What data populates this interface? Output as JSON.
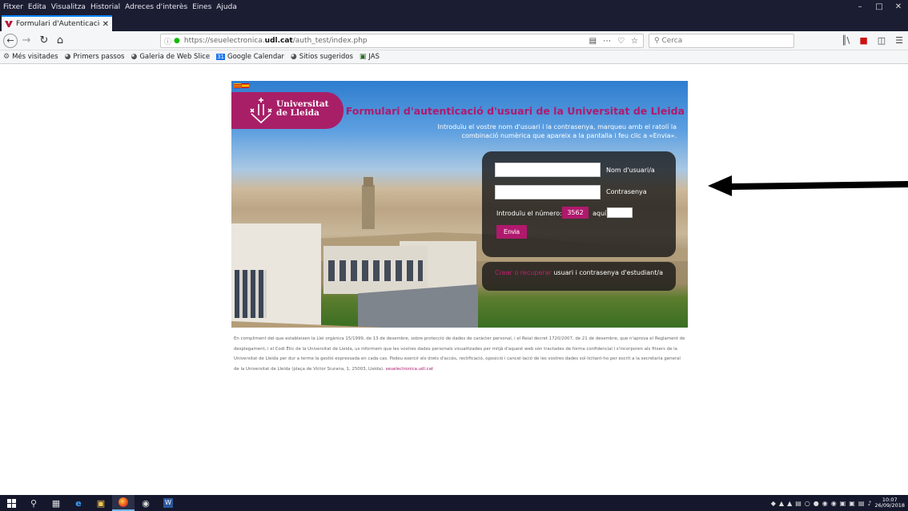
{
  "menubar": {
    "items": [
      "Fitxer",
      "Edita",
      "Visualitza",
      "Historial",
      "Adreces d'interès",
      "Eines",
      "Ajuda"
    ]
  },
  "tab": {
    "title": "Formulari d'Autenticació d'usu"
  },
  "address": {
    "url_prefix": "https://seuelectronica.",
    "url_host": "udl.cat",
    "url_path": "/auth_test/index.php"
  },
  "search": {
    "placeholder": "Cerca"
  },
  "bookmarks": [
    {
      "label": "Més visitades",
      "icon": "gear-icon"
    },
    {
      "label": "Primers passos",
      "icon": "globe-icon"
    },
    {
      "label": "Galeria de Web Slice",
      "icon": "globe-icon"
    },
    {
      "label": "Google Calendar",
      "icon": "calendar-icon"
    },
    {
      "label": "Sitios sugeridos",
      "icon": "globe-icon"
    },
    {
      "label": "JAS",
      "icon": "folder-icon"
    }
  ],
  "page": {
    "logo_line1": "Universitat",
    "logo_line2": "de Lleida",
    "form_title": "Formulari d'autenticació d'usuari de la Universitat de Lleida",
    "form_subtitle": "Introduïu el vostre nom d'usuari i la contrasenya, marqueu amb el ratolí la combinació numèrica que apareix a la pantalla i feu clic a «Envia».",
    "username_label": "Nom d'usuari/a",
    "password_label": "Contrasenya",
    "number_label": "Introduïu el número:",
    "number_value": "3562",
    "aqui_label": "aquí:",
    "send_button": "Envia",
    "recover_link": "Crear o recuperar",
    "recover_text": " usuari i contrasenya d'estudiant/a",
    "legal_text": "En compliment del que estableixen la Llei orgànica 15/1999, de 13 de desembre, sobre protecció de dades de caràcter personal, i el Reial decret 1720/2007, de 21 de desembre, que n'aprova el Reglament de desplegament, i el Codi Ètic de la Universitat de Lleida, us informem que les vostres dades personals visualitzades per mitjà d'aquest web són tractades de forma confidencial i s'incorporen als fitxers de la Universitat de Lleida per dur a terme la gestió expressada en cada cas. Podeu exercir els drets d'accés, rectificació, oposició i cancel·lació de les vostres dades sol·licitant-ho per escrit a la secretaria general de la Universitat de Lleida (plaça de Víctor Siurana, 1, 25003, Lleida).",
    "legal_link": "seuelectronica.udl.cat"
  },
  "taskbar": {
    "time": "10:07",
    "date": "26/09/2018"
  },
  "colors": {
    "brand": "#b0196d",
    "chrome_dark": "#1b1d32"
  }
}
